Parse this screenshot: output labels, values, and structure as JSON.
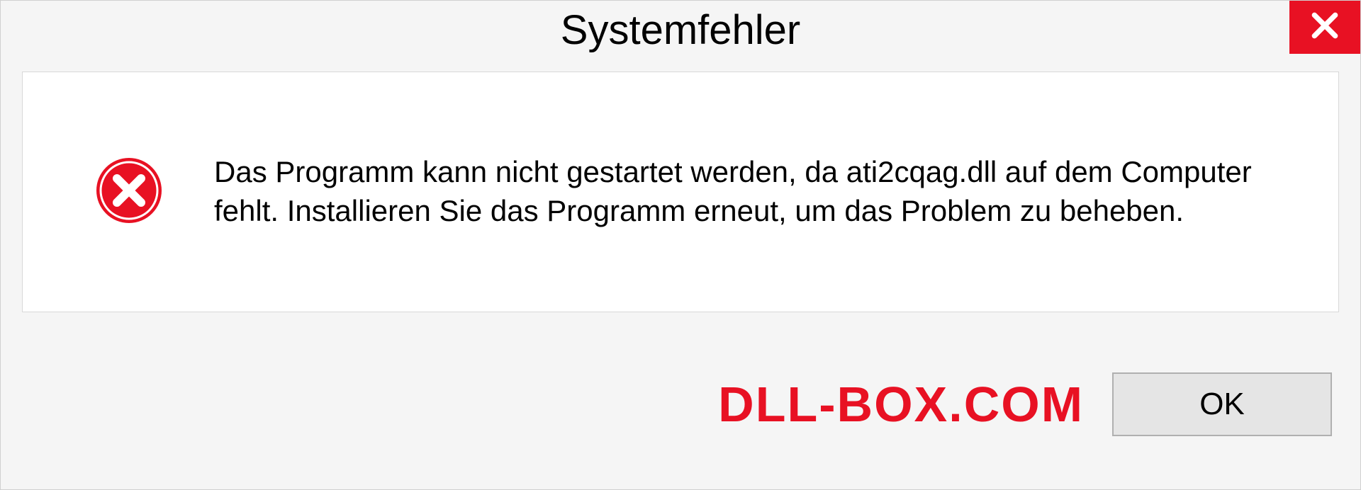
{
  "dialog": {
    "title": "Systemfehler",
    "message": "Das Programm kann nicht gestartet werden, da ati2cqag.dll auf dem Computer fehlt. Installieren Sie das Programm erneut, um das Problem zu beheben.",
    "ok_label": "OK"
  },
  "watermark": "DLL-BOX.COM",
  "colors": {
    "close_bg": "#e81123",
    "error_red": "#e81123"
  }
}
